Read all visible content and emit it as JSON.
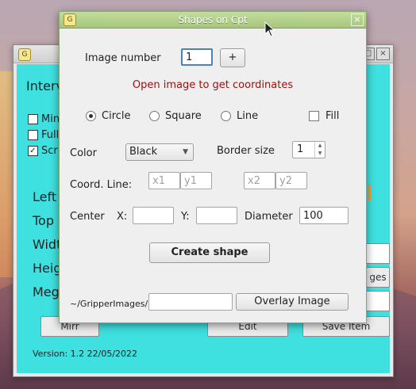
{
  "back_window": {
    "labels": [
      "Interv",
      "Min",
      "Full",
      "Scr",
      "Left",
      "Top",
      "Widt",
      "Heig",
      "Meg"
    ],
    "buttons": [
      "Mirr",
      "Edit",
      "ges",
      "Save",
      "Save Item"
    ],
    "version": "Version: 1.2   22/05/2022"
  },
  "dialog": {
    "title": "Shapes on Cpt",
    "close_icon": "close-icon",
    "image_number_label": "Image number",
    "image_number_value": "1",
    "plus_label": "+",
    "message": "Open image to get coordinates",
    "shapes": [
      {
        "label": "Circle",
        "selected": true
      },
      {
        "label": "Square",
        "selected": false
      },
      {
        "label": "Line",
        "selected": false
      }
    ],
    "fill_label": "Fill",
    "color_label": "Color",
    "color_value": "Black",
    "border_label": "Border size",
    "border_value": "1",
    "coord_label": "Coord. Line:",
    "coord_placeholders": {
      "x1": "x1",
      "y1": "y1",
      "x2": "x2",
      "y2": "y2"
    },
    "center_label": "Center",
    "x_label": "X:",
    "y_label": "Y:",
    "diameter_label": "Diameter",
    "diameter_value": "100",
    "create_label": "Create shape",
    "path_label": "~/GripperImages/",
    "overlay_label": "Overlay Image"
  },
  "colors": {
    "accent": "#4a7fd0",
    "message": "#a01010",
    "back_bg": "#3fe0e0",
    "title_bar": "#a6c67c"
  }
}
